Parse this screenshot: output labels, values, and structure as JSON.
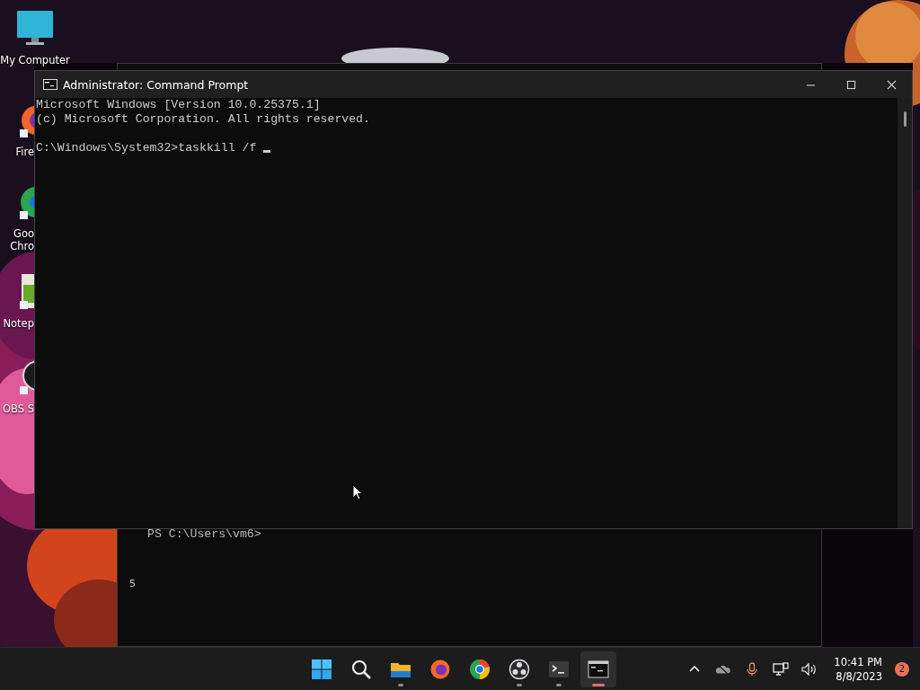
{
  "desktop_icons": [
    {
      "kind": "monitor",
      "lines": [
        "My Computer"
      ]
    },
    {
      "kind": "firefox",
      "lines": [
        "Fire"
      ]
    },
    {
      "kind": "chrome",
      "lines": [
        "Goo",
        "Chro"
      ]
    },
    {
      "kind": "notepad",
      "lines": [
        "Notep"
      ]
    },
    {
      "kind": "obs",
      "lines": [
        "OBS S"
      ]
    }
  ],
  "background_window": {
    "prompt": "PS C:\\Users\\vm6>",
    "side_text": "5"
  },
  "window": {
    "title": "Administrator: Command Prompt",
    "blocks": [
      [
        "Microsoft Windows [Version 10.0.25375.1]",
        "(c) Microsoft Corporation. All rights reserved."
      ],
      [
        "C:\\Windows\\System32>taskkill /f "
      ]
    ],
    "cursor": true
  },
  "taskbar": {
    "apps": [
      {
        "kind": "start",
        "running": false,
        "active": false
      },
      {
        "kind": "search",
        "running": false,
        "active": false
      },
      {
        "kind": "folder",
        "running": true,
        "active": false
      },
      {
        "kind": "firefox",
        "running": false,
        "active": false
      },
      {
        "kind": "chrome",
        "running": false,
        "active": false
      },
      {
        "kind": "obs",
        "running": true,
        "active": false
      },
      {
        "kind": "terminal",
        "running": true,
        "active": false
      },
      {
        "kind": "cmd",
        "running": true,
        "active": true
      }
    ],
    "time": "10:41 PM",
    "date": "8/8/2023",
    "notifications": "2"
  }
}
